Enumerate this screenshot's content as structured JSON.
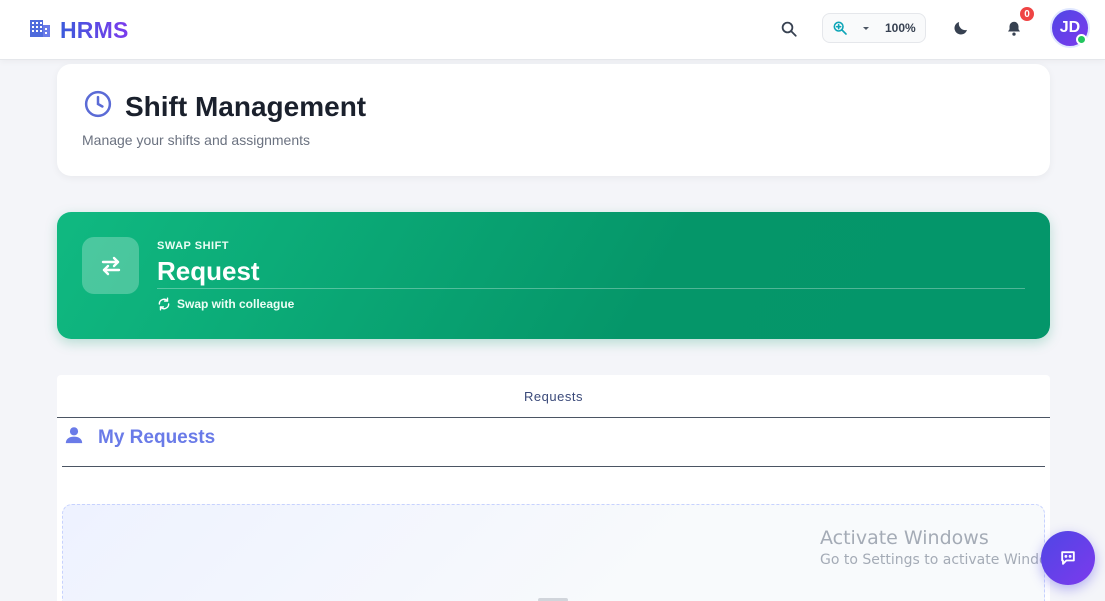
{
  "header": {
    "brand": "HRMS",
    "zoom": "100%",
    "notification_count": "0",
    "avatar_initials": "JD"
  },
  "page": {
    "title": "Shift Management",
    "subtitle": "Manage your shifts and assignments"
  },
  "swap_card": {
    "kicker": "SWAP SHIFT",
    "title": "Request",
    "meta": "Swap with colleague"
  },
  "requests": {
    "tab_label": "Requests",
    "section_title": "My Requests"
  },
  "watermark": {
    "line1": "Activate Windows",
    "line2": "Go to Settings to activate Windows."
  },
  "colors": {
    "brand_gradient_start": "#3b5bdb",
    "brand_gradient_end": "#7c3aed",
    "swap_green": "#10b981",
    "accent_indigo": "#6a7be8",
    "badge_red": "#ef4444",
    "online_green": "#22c55e"
  },
  "icons": {
    "brand": "building-icon",
    "search": "search-icon",
    "zoom": "zoom-in-icon",
    "zoom_caret": "caret-down-icon",
    "theme": "moon-icon",
    "notifications": "bell-icon",
    "title": "clock-icon",
    "swap": "swap-arrows-icon",
    "swap_meta": "refresh-icon",
    "my_requests": "user-icon",
    "chat": "chat-icon"
  }
}
